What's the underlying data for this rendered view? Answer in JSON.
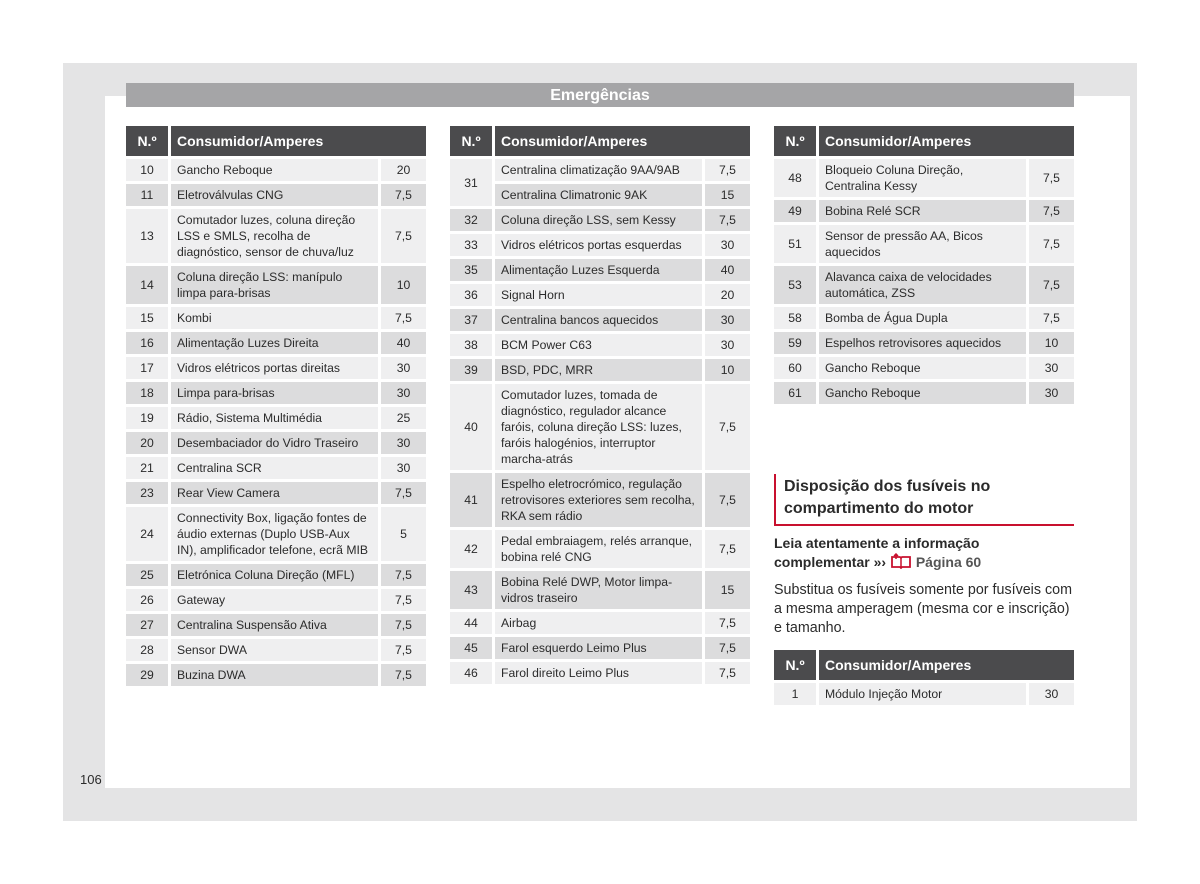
{
  "banner_title": "Emergências",
  "table_headers": {
    "number": "N.º",
    "consumer": "Consumidor/Amperes"
  },
  "table1": [
    {
      "n": "10",
      "c": "Gancho Reboque",
      "a": "20"
    },
    {
      "n": "11",
      "c": "Eletroválvulas CNG",
      "a": "7,5"
    },
    {
      "n": "13",
      "c": "Comutador luzes, coluna direção LSS e SMLS, recolha de diagnóstico, sensor de chuva/luz",
      "a": "7,5"
    },
    {
      "n": "14",
      "c": "Coluna direção LSS: manípulo limpa para-brisas",
      "a": "10"
    },
    {
      "n": "15",
      "c": "Kombi",
      "a": "7,5"
    },
    {
      "n": "16",
      "c": "Alimentação Luzes Direita",
      "a": "40"
    },
    {
      "n": "17",
      "c": "Vidros elétricos portas direitas",
      "a": "30"
    },
    {
      "n": "18",
      "c": "Limpa para-brisas",
      "a": "30"
    },
    {
      "n": "19",
      "c": "Rádio, Sistema Multimédia",
      "a": "25"
    },
    {
      "n": "20",
      "c": "Desembaciador do Vidro Traseiro",
      "a": "30"
    },
    {
      "n": "21",
      "c": "Centralina SCR",
      "a": "30"
    },
    {
      "n": "23",
      "c": "Rear View Camera",
      "a": "7,5"
    },
    {
      "n": "24",
      "c": "Connectivity Box, ligação fontes de áudio externas (Duplo USB-Aux IN), amplificador telefone, ecrã MIB",
      "a": "5"
    },
    {
      "n": "25",
      "c": "Eletrónica Coluna Direção (MFL)",
      "a": "7,5"
    },
    {
      "n": "26",
      "c": "Gateway",
      "a": "7,5"
    },
    {
      "n": "27",
      "c": "Centralina Suspensão Ativa",
      "a": "7,5"
    },
    {
      "n": "28",
      "c": "Sensor DWA",
      "a": "7,5"
    },
    {
      "n": "29",
      "c": "Buzina DWA",
      "a": "7,5"
    }
  ],
  "table2": [
    {
      "n": "31",
      "c": "Centralina climatização 9AA/9AB",
      "a": "7,5",
      "rowspan": 2
    },
    {
      "n": "",
      "c": "Centralina Climatronic 9AK",
      "a": "15",
      "cont": true
    },
    {
      "n": "32",
      "c": "Coluna direção LSS, sem Kessy",
      "a": "7,5"
    },
    {
      "n": "33",
      "c": "Vidros elétricos portas esquerdas",
      "a": "30"
    },
    {
      "n": "35",
      "c": "Alimentação Luzes Esquerda",
      "a": "40"
    },
    {
      "n": "36",
      "c": "Signal Horn",
      "a": "20"
    },
    {
      "n": "37",
      "c": "Centralina bancos aquecidos",
      "a": "30"
    },
    {
      "n": "38",
      "c": "BCM Power C63",
      "a": "30"
    },
    {
      "n": "39",
      "c": "BSD, PDC, MRR",
      "a": "10"
    },
    {
      "n": "40",
      "c": "Comutador luzes, tomada de diagnóstico, regulador alcance faróis, coluna direção LSS: luzes, faróis halogénios, interruptor marcha-atrás",
      "a": "7,5"
    },
    {
      "n": "41",
      "c": "Espelho eletrocrómico, regulação retrovisores exteriores sem recolha, RKA sem rádio",
      "a": "7,5"
    },
    {
      "n": "42",
      "c": "Pedal embraiagem, relés arranque, bobina relé CNG",
      "a": "7,5"
    },
    {
      "n": "43",
      "c": "Bobina Relé DWP, Motor limpa-vidros traseiro",
      "a": "15"
    },
    {
      "n": "44",
      "c": "Airbag",
      "a": "7,5"
    },
    {
      "n": "45",
      "c": "Farol esquerdo Leimo Plus",
      "a": "7,5"
    },
    {
      "n": "46",
      "c": "Farol direito Leimo Plus",
      "a": "7,5"
    }
  ],
  "table3": [
    {
      "n": "48",
      "c": "Bloqueio Coluna Direção, Centralina Kessy",
      "a": "7,5"
    },
    {
      "n": "49",
      "c": "Bobina Relé SCR",
      "a": "7,5"
    },
    {
      "n": "51",
      "c": "Sensor de pressão AA, Bicos aquecidos",
      "a": "7,5"
    },
    {
      "n": "53",
      "c": "Alavanca caixa de velocidades automática, ZSS",
      "a": "7,5"
    },
    {
      "n": "58",
      "c": "Bomba de Água Dupla",
      "a": "7,5"
    },
    {
      "n": "59",
      "c": "Espelhos retrovisores aquecidos",
      "a": "10"
    },
    {
      "n": "60",
      "c": "Gancho Reboque",
      "a": "30"
    },
    {
      "n": "61",
      "c": "Gancho Reboque",
      "a": "30"
    }
  ],
  "section": {
    "title": "Disposição dos fusíveis no compartimento do motor",
    "lead_text": "Leia atentamente a informação complementar »›",
    "lead_icon": "book-reference-icon",
    "lead_page": "Página 60",
    "body": "Substitua os fusíveis somente por fusíveis com a mesma amperagem (mesma cor e inscrição) e tamanho."
  },
  "table4": [
    {
      "n": "1",
      "c": "Módulo Injeção Motor",
      "a": "30"
    }
  ],
  "page_number": "106",
  "colors": {
    "header_bg": "#4b4b4d",
    "banner_bg": "#a5a5a7",
    "accent": "#c8102e",
    "row_light": "#efeff0",
    "row_dark": "#dcdcdd"
  }
}
